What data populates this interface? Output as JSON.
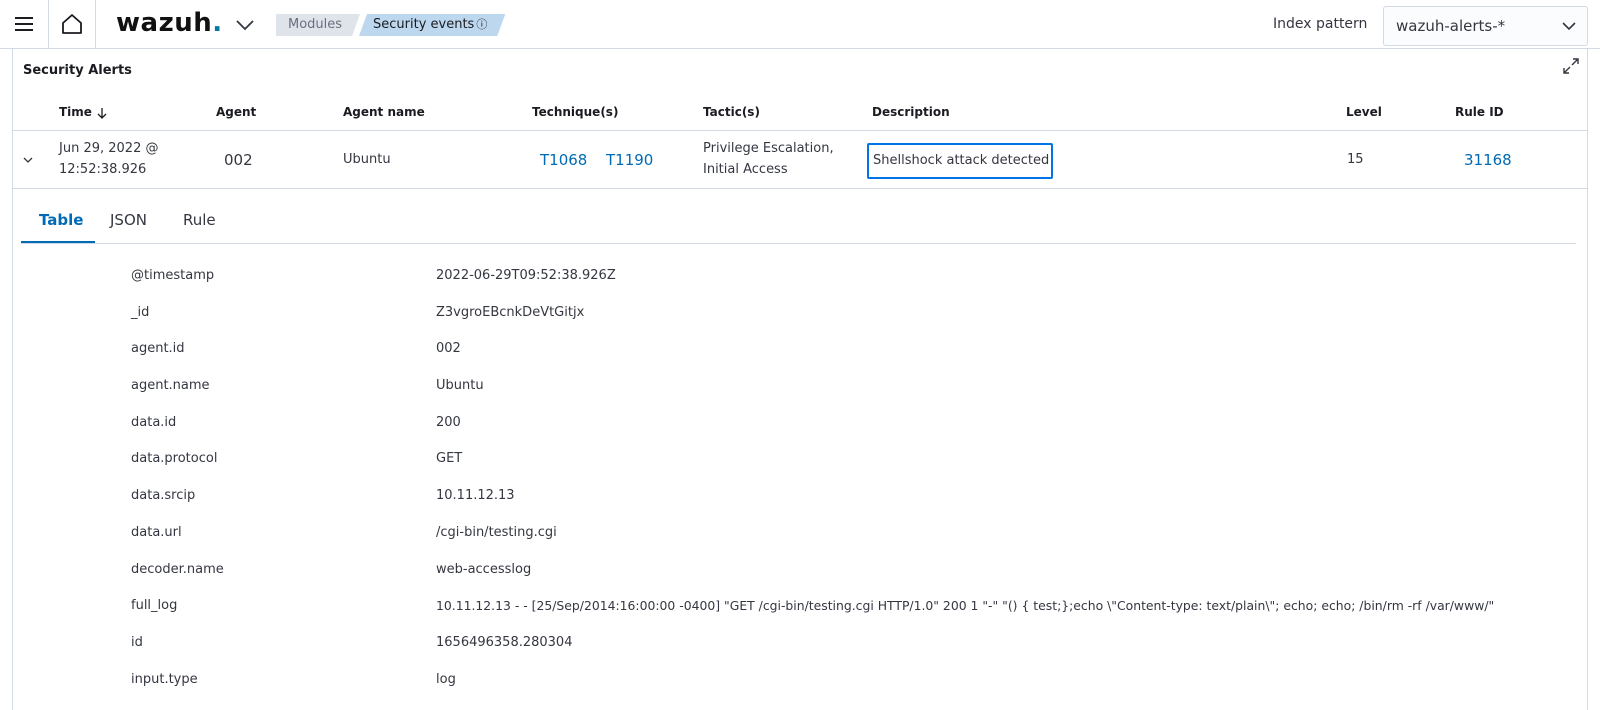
{
  "header": {
    "logo_text": "wazuh",
    "logo_dot": ".",
    "breadcrumb": [
      "Modules",
      "Security events"
    ],
    "breadcrumb_info_icon": "info-icon",
    "index_pattern_label": "Index pattern",
    "index_pattern_value": "wazuh-alerts-*"
  },
  "panel": {
    "title": "Security Alerts",
    "columns": [
      "Time",
      "Agent",
      "Agent name",
      "Technique(s)",
      "Tactic(s)",
      "Description",
      "Level",
      "Rule ID"
    ],
    "row": {
      "time_line1": "Jun 29, 2022 @",
      "time_line2": "12:52:38.926",
      "agent": "002",
      "agent_name": "Ubuntu",
      "techniques": [
        "T1068",
        "T1190"
      ],
      "tactic_line1": "Privilege Escalation,",
      "tactic_line2": "Initial Access",
      "description": "Shellshock attack detected",
      "level": "15",
      "rule_id": "31168"
    }
  },
  "tabs": [
    "Table",
    "JSON",
    "Rule"
  ],
  "details": [
    {
      "key": "@timestamp",
      "value": "2022-06-29T09:52:38.926Z"
    },
    {
      "key": "_id",
      "value": "Z3vgroEBcnkDeVtGitjx"
    },
    {
      "key": "agent.id",
      "value": "002"
    },
    {
      "key": "agent.name",
      "value": "Ubuntu"
    },
    {
      "key": "data.id",
      "value": "200"
    },
    {
      "key": "data.protocol",
      "value": "GET"
    },
    {
      "key": "data.srcip",
      "value": "10.11.12.13"
    },
    {
      "key": "data.url",
      "value": "/cgi-bin/testing.cgi"
    },
    {
      "key": "decoder.name",
      "value": "web-accesslog"
    },
    {
      "key": "full_log",
      "value": "10.11.12.13 - - [25/Sep/2014:16:00:00 -0400] \"GET /cgi-bin/testing.cgi HTTP/1.0\" 200 1 \"-\" \"() { test;};echo \\\"Content-type: text/plain\\\"; echo; echo; /bin/rm -rf /var/www/\""
    },
    {
      "key": "id",
      "value": "1656496358.280304"
    },
    {
      "key": "input.type",
      "value": "log"
    }
  ],
  "colors": {
    "accent": "#006bb4",
    "focus": "#0073e6",
    "border": "#d3dae6"
  }
}
